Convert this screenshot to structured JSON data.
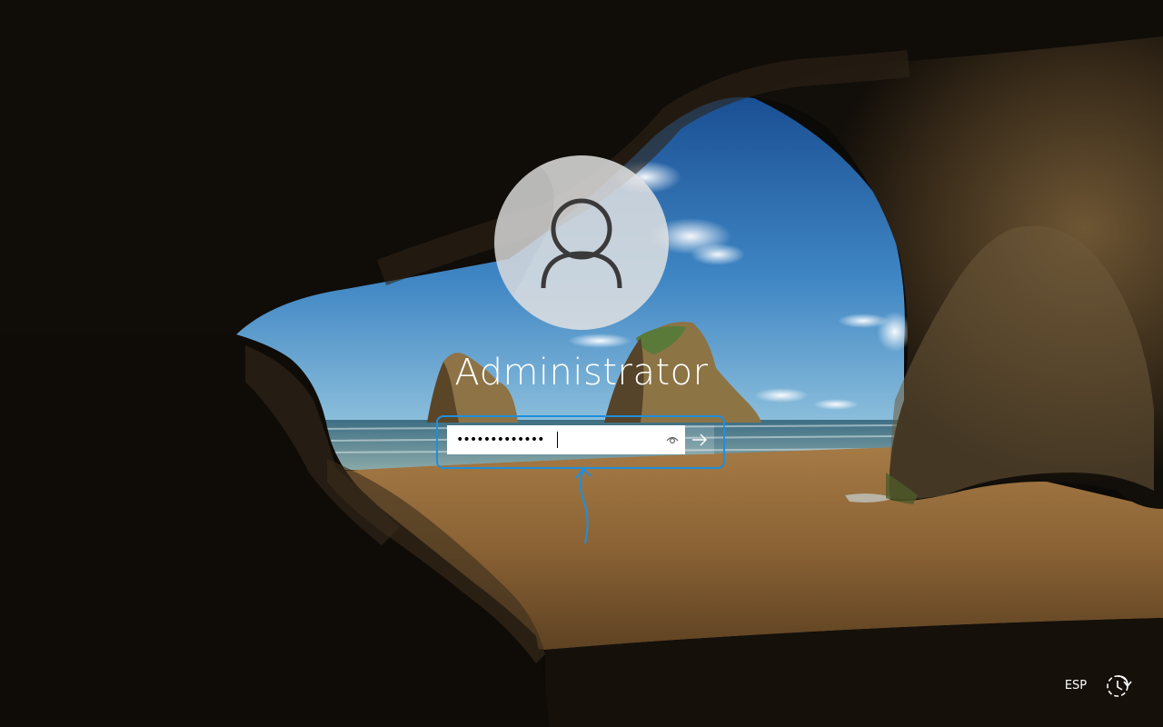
{
  "lock_screen": {
    "user": {
      "name": "Administrator",
      "avatar_icon": "user-silhouette-icon"
    },
    "password_field": {
      "value": "•••••••••••••",
      "reveal_icon": "eye-icon"
    },
    "submit_icon": "arrow-right-icon",
    "annotation": {
      "color": "#1d8fe0"
    }
  },
  "taskbar": {
    "language": "ESP",
    "accessibility_icon": "ease-of-access-icon"
  }
}
